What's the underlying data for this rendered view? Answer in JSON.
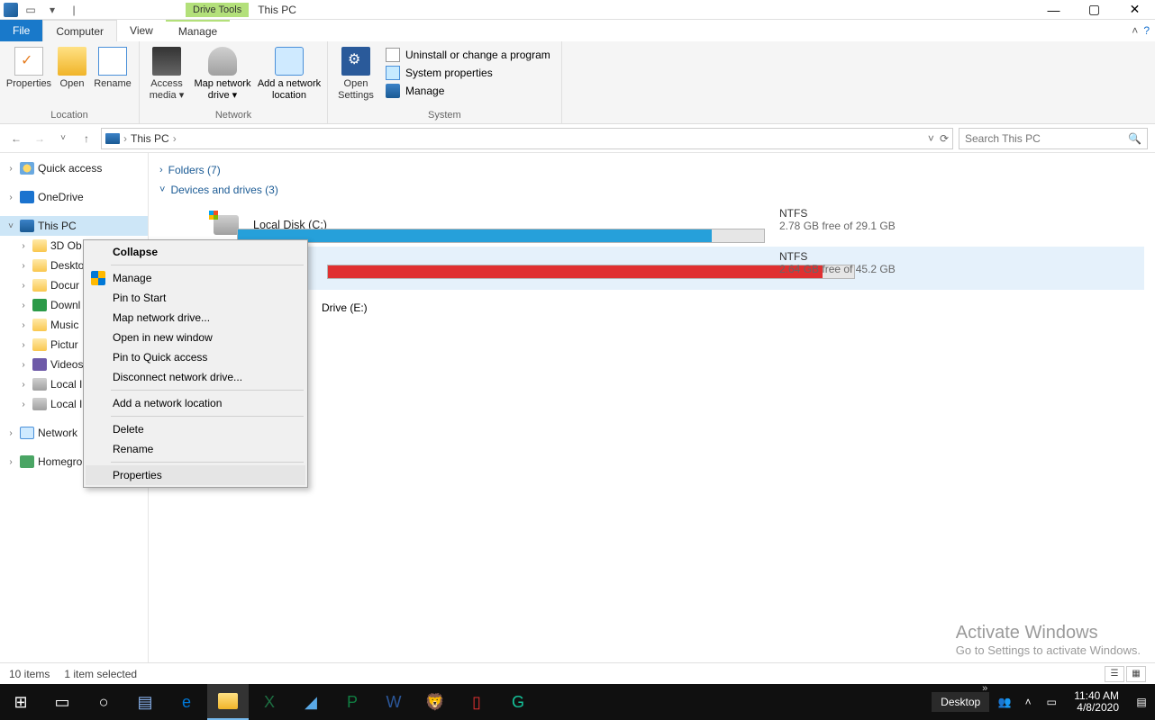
{
  "titlebar": {
    "drive_tools": "Drive Tools",
    "title": "This PC"
  },
  "tabs": {
    "file": "File",
    "computer": "Computer",
    "view": "View",
    "manage": "Manage"
  },
  "ribbon": {
    "location": {
      "properties": "Properties",
      "open": "Open",
      "rename": "Rename",
      "group": "Location"
    },
    "network": {
      "access_media": "Access media ▾",
      "map_drive": "Map network drive ▾",
      "add_loc": "Add a network location",
      "group": "Network"
    },
    "system": {
      "open_settings": "Open Settings",
      "uninstall": "Uninstall or change a program",
      "sysprops": "System properties",
      "manage": "Manage",
      "group": "System"
    }
  },
  "address": {
    "crumb": "This PC",
    "search_placeholder": "Search This PC"
  },
  "tree": {
    "quick_access": "Quick access",
    "onedrive": "OneDrive",
    "this_pc": "This PC",
    "items": [
      "3D Ob",
      "Deskto",
      "Docur",
      "Downl",
      "Music",
      "Pictur",
      "Videos",
      "Local I",
      "Local I"
    ],
    "network": "Network",
    "homegroup": "Homegroup"
  },
  "content": {
    "folders_head": "Folders (7)",
    "devices_head": "Devices and drives (3)",
    "drives": [
      {
        "name": "Local Disk (C:)",
        "fs": "NTFS",
        "free": "2.78 GB free of 29.1 GB",
        "fill_pct": 90,
        "fill_color": "#26a0da"
      },
      {
        "name": "",
        "fs": "NTFS",
        "free": "2.64 GB free of 45.2 GB",
        "fill_pct": 94,
        "fill_color": "#e03030"
      }
    ],
    "dvd": "Drive (E:)"
  },
  "context_menu": {
    "collapse": "Collapse",
    "manage": "Manage",
    "pin_start": "Pin to Start",
    "map_drive": "Map network drive...",
    "open_new": "Open in new window",
    "pin_quick": "Pin to Quick access",
    "disconnect": "Disconnect network drive...",
    "add_loc": "Add a network location",
    "delete": "Delete",
    "rename": "Rename",
    "properties": "Properties"
  },
  "statusbar": {
    "items": "10 items",
    "selected": "1 item selected"
  },
  "watermark": {
    "title": "Activate Windows",
    "sub": "Go to Settings to activate Windows."
  },
  "taskbar": {
    "desktop": "Desktop",
    "time": "11:40 AM",
    "date": "4/8/2020"
  }
}
